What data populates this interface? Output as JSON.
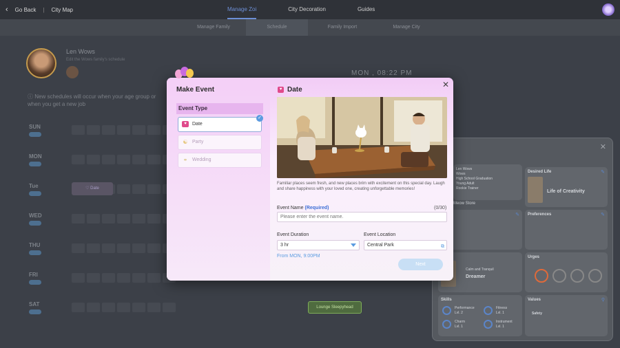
{
  "topbar": {
    "back_label": "Go Back",
    "city_map_label": "City Map",
    "tabs": [
      {
        "label": "Manage Zoi",
        "active": true
      },
      {
        "label": "City Decoration",
        "active": false
      },
      {
        "label": "Guides",
        "active": false
      }
    ]
  },
  "subtabs": [
    {
      "label": "Manage Family",
      "active": false
    },
    {
      "label": "Schedule",
      "active": true
    },
    {
      "label": "Family Import",
      "active": false
    },
    {
      "label": "Manage City",
      "active": false
    }
  ],
  "profile": {
    "name": "Len Wows",
    "subtitle": "Edit the Wows family's schedule"
  },
  "clock": "MON , 08:22 PM",
  "notice": "New schedules will occur when your age group or when you get a new job",
  "days": [
    "SUN",
    "MON",
    "Tue",
    "WED",
    "THU",
    "FRI",
    "SAT"
  ],
  "background_events": {
    "tuesday_event": "Date",
    "saturday_event": "Lounge Sleepyhead"
  },
  "side_panel": {
    "info_lines": [
      "Len Wows",
      "Wows",
      "High School Graduation",
      "Young Adult",
      "Rookie Trainer",
      "Meow Store"
    ],
    "desired_life_label": "Desired Life",
    "desired_life_value": "Life of Creativity",
    "preferences_label": "Preferences",
    "urges_label": "Urges",
    "dreamer_caption": "Calm and Tranquil",
    "dreamer_label": "Dreamer",
    "skills_label": "Skills",
    "values_label": "Values",
    "values_item": "Safety",
    "skills": [
      {
        "name": "Performance",
        "level": "Lvl. 2"
      },
      {
        "name": "Fitness",
        "level": "Lvl. 1"
      },
      {
        "name": "Charm",
        "level": "Lvl. 1"
      },
      {
        "name": "Instrument",
        "level": "Lvl. 1"
      }
    ]
  },
  "modal": {
    "title": "Make Event",
    "event_type_label": "Event Type",
    "event_types": [
      {
        "label": "Date",
        "selected": true,
        "icon": "heart-calendar-icon"
      },
      {
        "label": "Party",
        "selected": false,
        "icon": "party-icon"
      },
      {
        "label": "Wedding",
        "selected": false,
        "icon": "wedding-icon"
      }
    ],
    "detail_title": "Date",
    "description": "Familiar places seem fresh, and new places brim with excitement on this special day. Laugh and share happiness with your loved one, creating unforgettable memories!",
    "event_name_label": "Event Name",
    "required_label": "(Required)",
    "name_counter": "(0/30)",
    "name_placeholder": "Please enter the event name.",
    "duration_label": "Event Duration",
    "duration_value": "3 hr",
    "location_label": "Event Location",
    "location_value": "Central Park",
    "from_text": "From MON, 9:00PM",
    "next_label": "Next"
  },
  "colors": {
    "accent": "#5b9be0",
    "modal_pink": "#f2ccf6",
    "active_tab": "#6d8fd6"
  }
}
